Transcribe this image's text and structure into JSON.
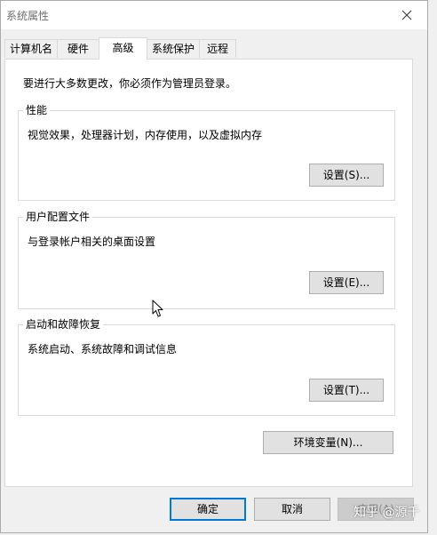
{
  "window": {
    "title": "系统属性"
  },
  "tabs": [
    {
      "label": "计算机名",
      "active": false
    },
    {
      "label": "硬件",
      "active": false
    },
    {
      "label": "高级",
      "active": true
    },
    {
      "label": "系统保护",
      "active": false
    },
    {
      "label": "远程",
      "active": false
    }
  ],
  "notice": "要进行大多数更改，你必须作为管理员登录。",
  "performance": {
    "title": "性能",
    "description": "视觉效果，处理器计划，内存使用，以及虚拟内存",
    "button": "设置(S)..."
  },
  "user_profiles": {
    "title": "用户配置文件",
    "description": "与登录帐户相关的桌面设置",
    "button": "设置(E)..."
  },
  "startup_recovery": {
    "title": "启动和故障恢复",
    "description": "系统启动、系统故障和调试信息",
    "button": "设置(T)..."
  },
  "env_button": "环境变量(N)...",
  "footer": {
    "ok": "确定",
    "cancel": "取消",
    "apply": "应用(A)"
  },
  "watermark": "知乎 @源千",
  "colors": {
    "accent": "#0078d7",
    "panel_bg": "#ffffff",
    "window_bg": "#f0f0f0"
  }
}
